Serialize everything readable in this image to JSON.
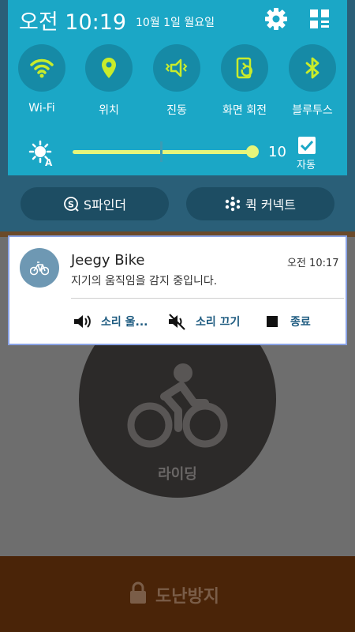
{
  "status_bar": {
    "time": "오전 10:19",
    "date": "10월 1일 월요일"
  },
  "quick_settings": [
    {
      "label": "Wi-Fi",
      "icon": "wifi-icon"
    },
    {
      "label": "위치",
      "icon": "location-pin-icon"
    },
    {
      "label": "진동",
      "icon": "vibrate-icon"
    },
    {
      "label": "화면 회전",
      "icon": "screen-rotation-icon"
    },
    {
      "label": "블루투스",
      "icon": "bluetooth-icon"
    }
  ],
  "brightness": {
    "value": "10",
    "level": 1.0,
    "auto_label": "자동",
    "auto_checked": true
  },
  "shortcuts": {
    "finder_label": "S파인더",
    "quick_connect_label": "퀵 커넥트"
  },
  "notification": {
    "app_name": "Jeegy Bike",
    "time": "오전 10:17",
    "text": "지기의 움직임을 감지 중입니다.",
    "actions": [
      {
        "label": "소리 울...",
        "icon": "volume-icon"
      },
      {
        "label": "소리 끄기",
        "icon": "mute-icon"
      },
      {
        "label": "종료",
        "icon": "stop-icon"
      }
    ]
  },
  "app": {
    "ride_label": "라이딩",
    "antitheft_label": "도난방지"
  },
  "colors": {
    "panel": "#1ba7c6",
    "toggle_active": "#c9ec2b",
    "accent_blue": "#1e5b80",
    "background_dim": "#6e6e6e"
  }
}
